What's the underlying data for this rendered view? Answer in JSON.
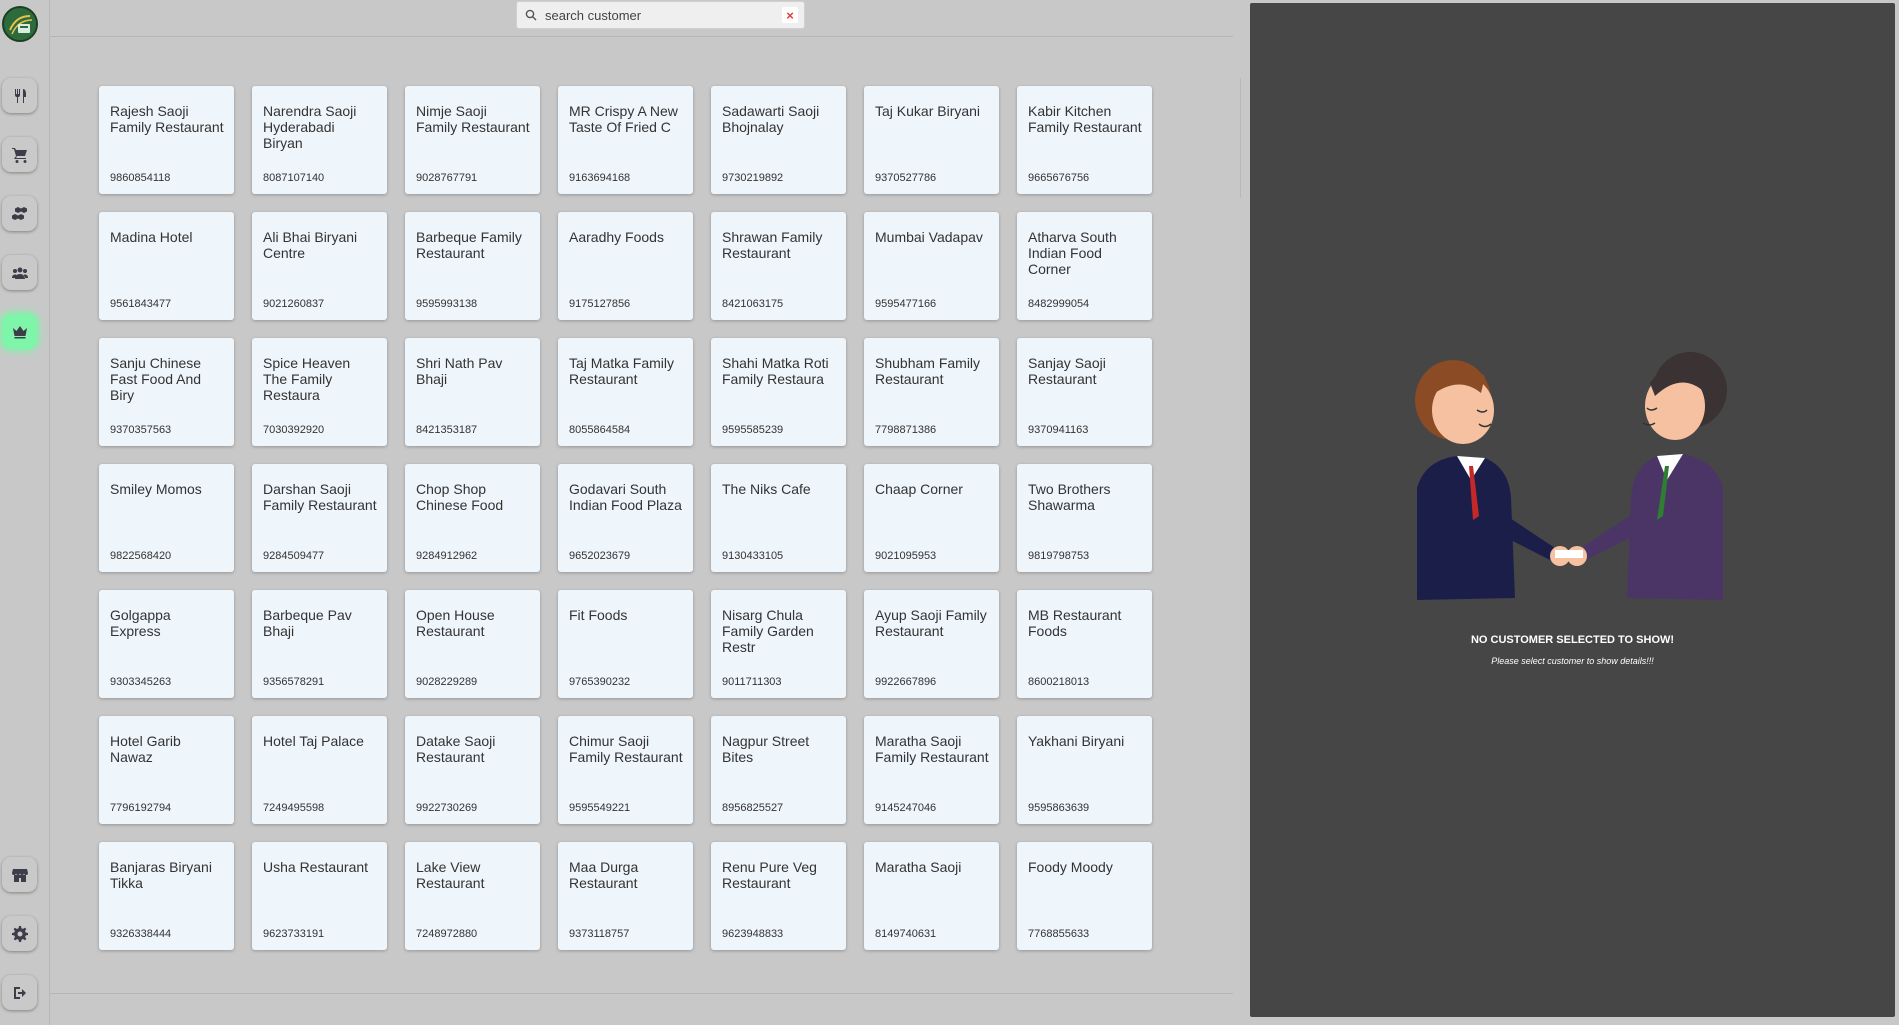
{
  "search": {
    "placeholder": "search customer",
    "clear_label": "×"
  },
  "sidebar": {
    "items": [
      {
        "icon": "utensils-icon"
      },
      {
        "icon": "cart-icon"
      },
      {
        "icon": "boxes-icon"
      },
      {
        "icon": "users-icon"
      },
      {
        "icon": "crown-icon",
        "active": true
      },
      {
        "icon": "store-icon"
      },
      {
        "icon": "gear-icon"
      },
      {
        "icon": "logout-icon"
      }
    ]
  },
  "customers": [
    {
      "name": "Rajesh Saoji Family Restaurant",
      "phone": "9860854118"
    },
    {
      "name": "Narendra Saoji Hyderabadi Biryan",
      "phone": "8087107140"
    },
    {
      "name": "Nimje Saoji Family Restaurant",
      "phone": "9028767791"
    },
    {
      "name": "MR Crispy A New Taste Of Fried C",
      "phone": "9163694168"
    },
    {
      "name": "Sadawarti Saoji Bhojnalay",
      "phone": "9730219892"
    },
    {
      "name": "Taj Kukar Biryani",
      "phone": "9370527786"
    },
    {
      "name": "Kabir Kitchen Family Restaurant",
      "phone": "9665676756"
    },
    {
      "name": "Madina Hotel",
      "phone": "9561843477"
    },
    {
      "name": "Ali Bhai Biryani Centre",
      "phone": "9021260837"
    },
    {
      "name": "Barbeque Family Restaurant",
      "phone": "9595993138"
    },
    {
      "name": "Aaradhy Foods",
      "phone": "9175127856"
    },
    {
      "name": "Shrawan Family Restaurant",
      "phone": "8421063175"
    },
    {
      "name": "Mumbai Vadapav",
      "phone": "9595477166"
    },
    {
      "name": "Atharva South Indian Food Corner",
      "phone": "8482999054"
    },
    {
      "name": "Sanju Chinese Fast Food And Biry",
      "phone": "9370357563"
    },
    {
      "name": "Spice Heaven The Family Restaura",
      "phone": "7030392920"
    },
    {
      "name": "Shri Nath Pav Bhaji",
      "phone": "8421353187"
    },
    {
      "name": "Taj Matka Family Restaurant",
      "phone": "8055864584"
    },
    {
      "name": "Shahi Matka Roti Family Restaura",
      "phone": "9595585239"
    },
    {
      "name": "Shubham Family Restaurant",
      "phone": "7798871386"
    },
    {
      "name": "Sanjay Saoji Restaurant",
      "phone": "9370941163"
    },
    {
      "name": "Smiley Momos",
      "phone": "9822568420"
    },
    {
      "name": "Darshan Saoji Family Restaurant",
      "phone": "9284509477"
    },
    {
      "name": "Chop Shop Chinese Food",
      "phone": "9284912962"
    },
    {
      "name": "Godavari South Indian Food Plaza",
      "phone": "9652023679"
    },
    {
      "name": "The Niks Cafe",
      "phone": "9130433105"
    },
    {
      "name": "Chaap Corner",
      "phone": "9021095953"
    },
    {
      "name": "Two Brothers Shawarma",
      "phone": "9819798753"
    },
    {
      "name": "Golgappa Express",
      "phone": "9303345263"
    },
    {
      "name": "Barbeque Pav Bhaji",
      "phone": "9356578291"
    },
    {
      "name": "Open House Restaurant",
      "phone": "9028229289"
    },
    {
      "name": "Fit Foods",
      "phone": "9765390232"
    },
    {
      "name": "Nisarg Chula Family Garden Restr",
      "phone": "9011711303"
    },
    {
      "name": "Ayup Saoji Family Restaurant",
      "phone": "9922667896"
    },
    {
      "name": "MB Restaurant Foods",
      "phone": "8600218013"
    },
    {
      "name": "Hotel Garib Nawaz",
      "phone": "7796192794"
    },
    {
      "name": "Hotel Taj Palace",
      "phone": "7249495598"
    },
    {
      "name": "Datake Saoji Restaurant",
      "phone": "9922730269"
    },
    {
      "name": "Chimur Saoji Family Restaurant",
      "phone": "9595549221"
    },
    {
      "name": "Nagpur Street Bites",
      "phone": "8956825527"
    },
    {
      "name": "Maratha Saoji Family Restaurant",
      "phone": "9145247046"
    },
    {
      "name": "Yakhani Biryani",
      "phone": "9595863639"
    },
    {
      "name": "Banjaras Biryani Tikka",
      "phone": "9326338444"
    },
    {
      "name": "Usha Restaurant",
      "phone": "9623733191"
    },
    {
      "name": "Lake View Restaurant",
      "phone": "7248972880"
    },
    {
      "name": "Maa Durga Restaurant",
      "phone": "9373118757"
    },
    {
      "name": "Renu Pure Veg Restaurant",
      "phone": "9623948833"
    },
    {
      "name": "Maratha Saoji",
      "phone": "8149740631"
    },
    {
      "name": "Foody Moody",
      "phone": "7768855633"
    }
  ],
  "detail": {
    "empty_title": "NO CUSTOMER SELECTED TO SHOW!",
    "empty_subtitle": "Please select customer to show details!!!",
    "colors": {
      "panel_bg": "#464646",
      "accent_active": "#7ef5a9",
      "card_bg": "#eef5fb"
    }
  }
}
